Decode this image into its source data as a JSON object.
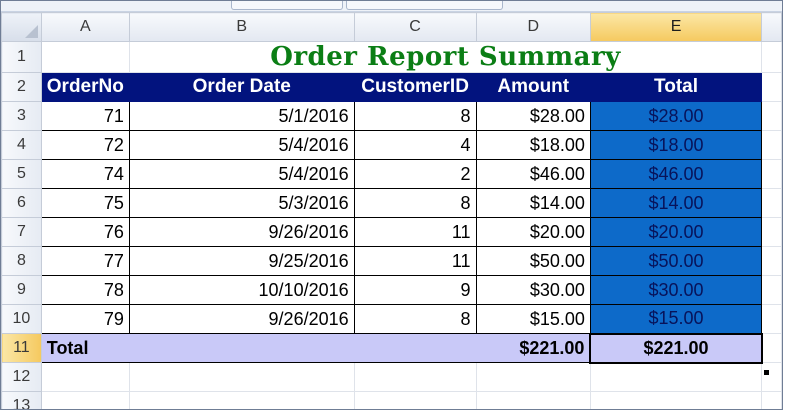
{
  "column_headers": [
    "A",
    "B",
    "C",
    "D",
    "E"
  ],
  "selected_column": "E",
  "row_numbers": [
    "1",
    "2",
    "3",
    "4",
    "5",
    "6",
    "7",
    "8",
    "9",
    "10",
    "11",
    "12",
    "13"
  ],
  "title": "Order Report Summary",
  "header": {
    "order_no": "OrderNo",
    "order_date": "Order Date",
    "customer_id": "CustomerID",
    "amount": "Amount",
    "total": "Total"
  },
  "rows": [
    {
      "order_no": "71",
      "order_date": "5/1/2016",
      "customer_id": "8",
      "amount": "$28.00",
      "total": "$28.00"
    },
    {
      "order_no": "72",
      "order_date": "5/4/2016",
      "customer_id": "4",
      "amount": "$18.00",
      "total": "$18.00"
    },
    {
      "order_no": "74",
      "order_date": "5/4/2016",
      "customer_id": "2",
      "amount": "$46.00",
      "total": "$46.00"
    },
    {
      "order_no": "75",
      "order_date": "5/3/2016",
      "customer_id": "8",
      "amount": "$14.00",
      "total": "$14.00"
    },
    {
      "order_no": "76",
      "order_date": "9/26/2016",
      "customer_id": "11",
      "amount": "$20.00",
      "total": "$20.00"
    },
    {
      "order_no": "77",
      "order_date": "9/25/2016",
      "customer_id": "11",
      "amount": "$50.00",
      "total": "$50.00"
    },
    {
      "order_no": "78",
      "order_date": "10/10/2016",
      "customer_id": "9",
      "amount": "$30.00",
      "total": "$30.00"
    },
    {
      "order_no": "79",
      "order_date": "9/26/2016",
      "customer_id": "8",
      "amount": "$15.00",
      "total": "$15.00"
    }
  ],
  "total_row": {
    "label": "Total",
    "amount": "$221.00",
    "total": "$221.00"
  },
  "colors": {
    "title_green": "#0b7e15",
    "header_navy": "#02137e",
    "total_column_blue": "#0d6ac9",
    "total_row_lavender": "#c9c9f8",
    "selected_header_gold": "#f5c95f"
  }
}
